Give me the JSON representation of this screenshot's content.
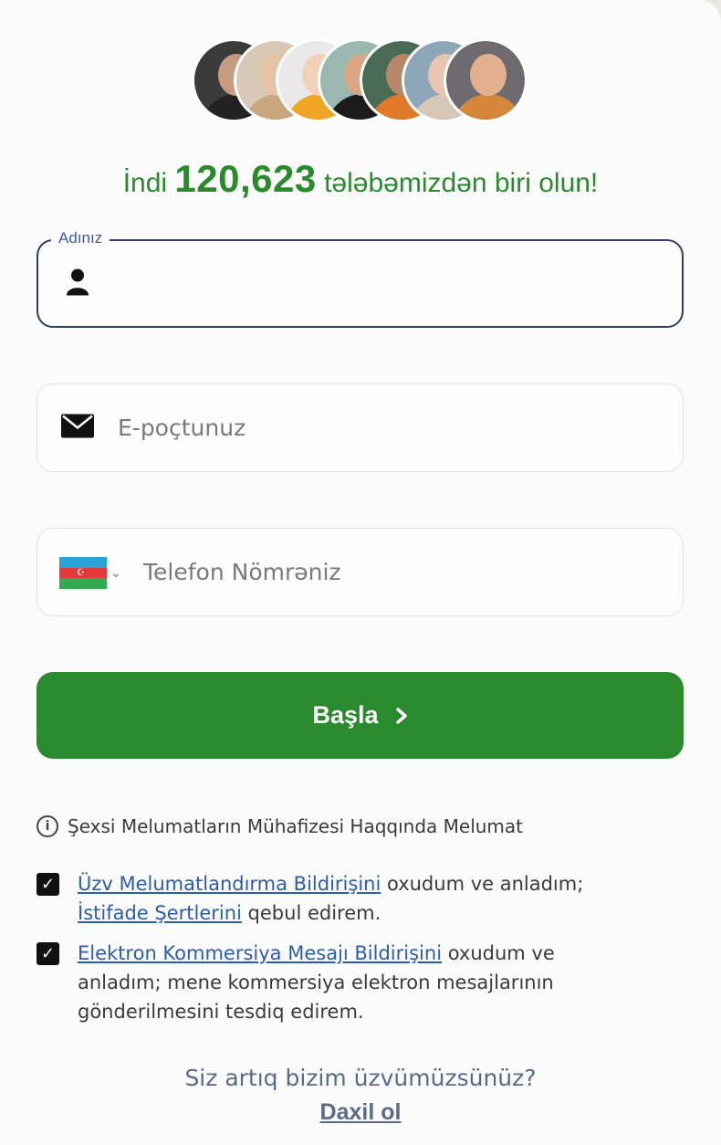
{
  "headline": {
    "prefix": "İndi",
    "count": "120,623",
    "suffix": "tələbəmizdən biri olun!"
  },
  "avatars": [
    {
      "name": "avatar-1",
      "bg": "#3b3b3b",
      "skin": "#c79a82",
      "shirt": "#222222"
    },
    {
      "name": "avatar-2",
      "bg": "#d8c8b5",
      "skin": "#e6c3a5",
      "shirt": "#c9a77e"
    },
    {
      "name": "avatar-3",
      "bg": "#e9e9e9",
      "skin": "#f1d2b8",
      "shirt": "#f1a526"
    },
    {
      "name": "avatar-4",
      "bg": "#9ab7b0",
      "skin": "#d9a784",
      "shirt": "#1b1b1b"
    },
    {
      "name": "avatar-5",
      "bg": "#4a6b55",
      "skin": "#b8876a",
      "shirt": "#e07a2a"
    },
    {
      "name": "avatar-6",
      "bg": "#8da6b8",
      "skin": "#e6c6b0",
      "shirt": "#d6c6b6"
    },
    {
      "name": "avatar-7",
      "bg": "#6d6b70",
      "skin": "#e2b08f",
      "shirt": "#d4873a"
    }
  ],
  "form": {
    "name": {
      "label": "Adınız",
      "value": "",
      "icon": "user-icon"
    },
    "email": {
      "placeholder": "E-poçtunuz",
      "icon": "mail-icon"
    },
    "phone": {
      "placeholder": "Telefon Nömrəniz",
      "country_flag": "azerbaijan-flag",
      "flag_colors": [
        "#2aa4d6",
        "#e23a3a",
        "#34a853"
      ]
    }
  },
  "start_button": {
    "label": "Başla",
    "icon": "chevron-right-icon"
  },
  "info": {
    "text": "Şexsi Melumatların Mühafizesi Haqqında Melumat",
    "icon": "info-icon"
  },
  "consents": [
    {
      "checked": true,
      "link1": "Üzv Melumatlandırma Bildirişini",
      "text1": " oxudum ve anladım;",
      "link2": "İstifade Şertlerini",
      "text2": " qebul edirem."
    },
    {
      "checked": true,
      "link1": "Elektron Kommersiya Mesajı Bildirişini",
      "text1": " oxudum ve anladım; mene kommersiya elektron mesajlarının gönderilmesini tesdiq edirem."
    }
  ],
  "footer": {
    "question": "Siz artıq bizim üzvümüzsünüz?",
    "login_link": "Daxil ol"
  },
  "colors": {
    "accent_green": "#2b8a2e",
    "link_blue": "#2d5da8",
    "muted_navy": "#5a6a88"
  }
}
